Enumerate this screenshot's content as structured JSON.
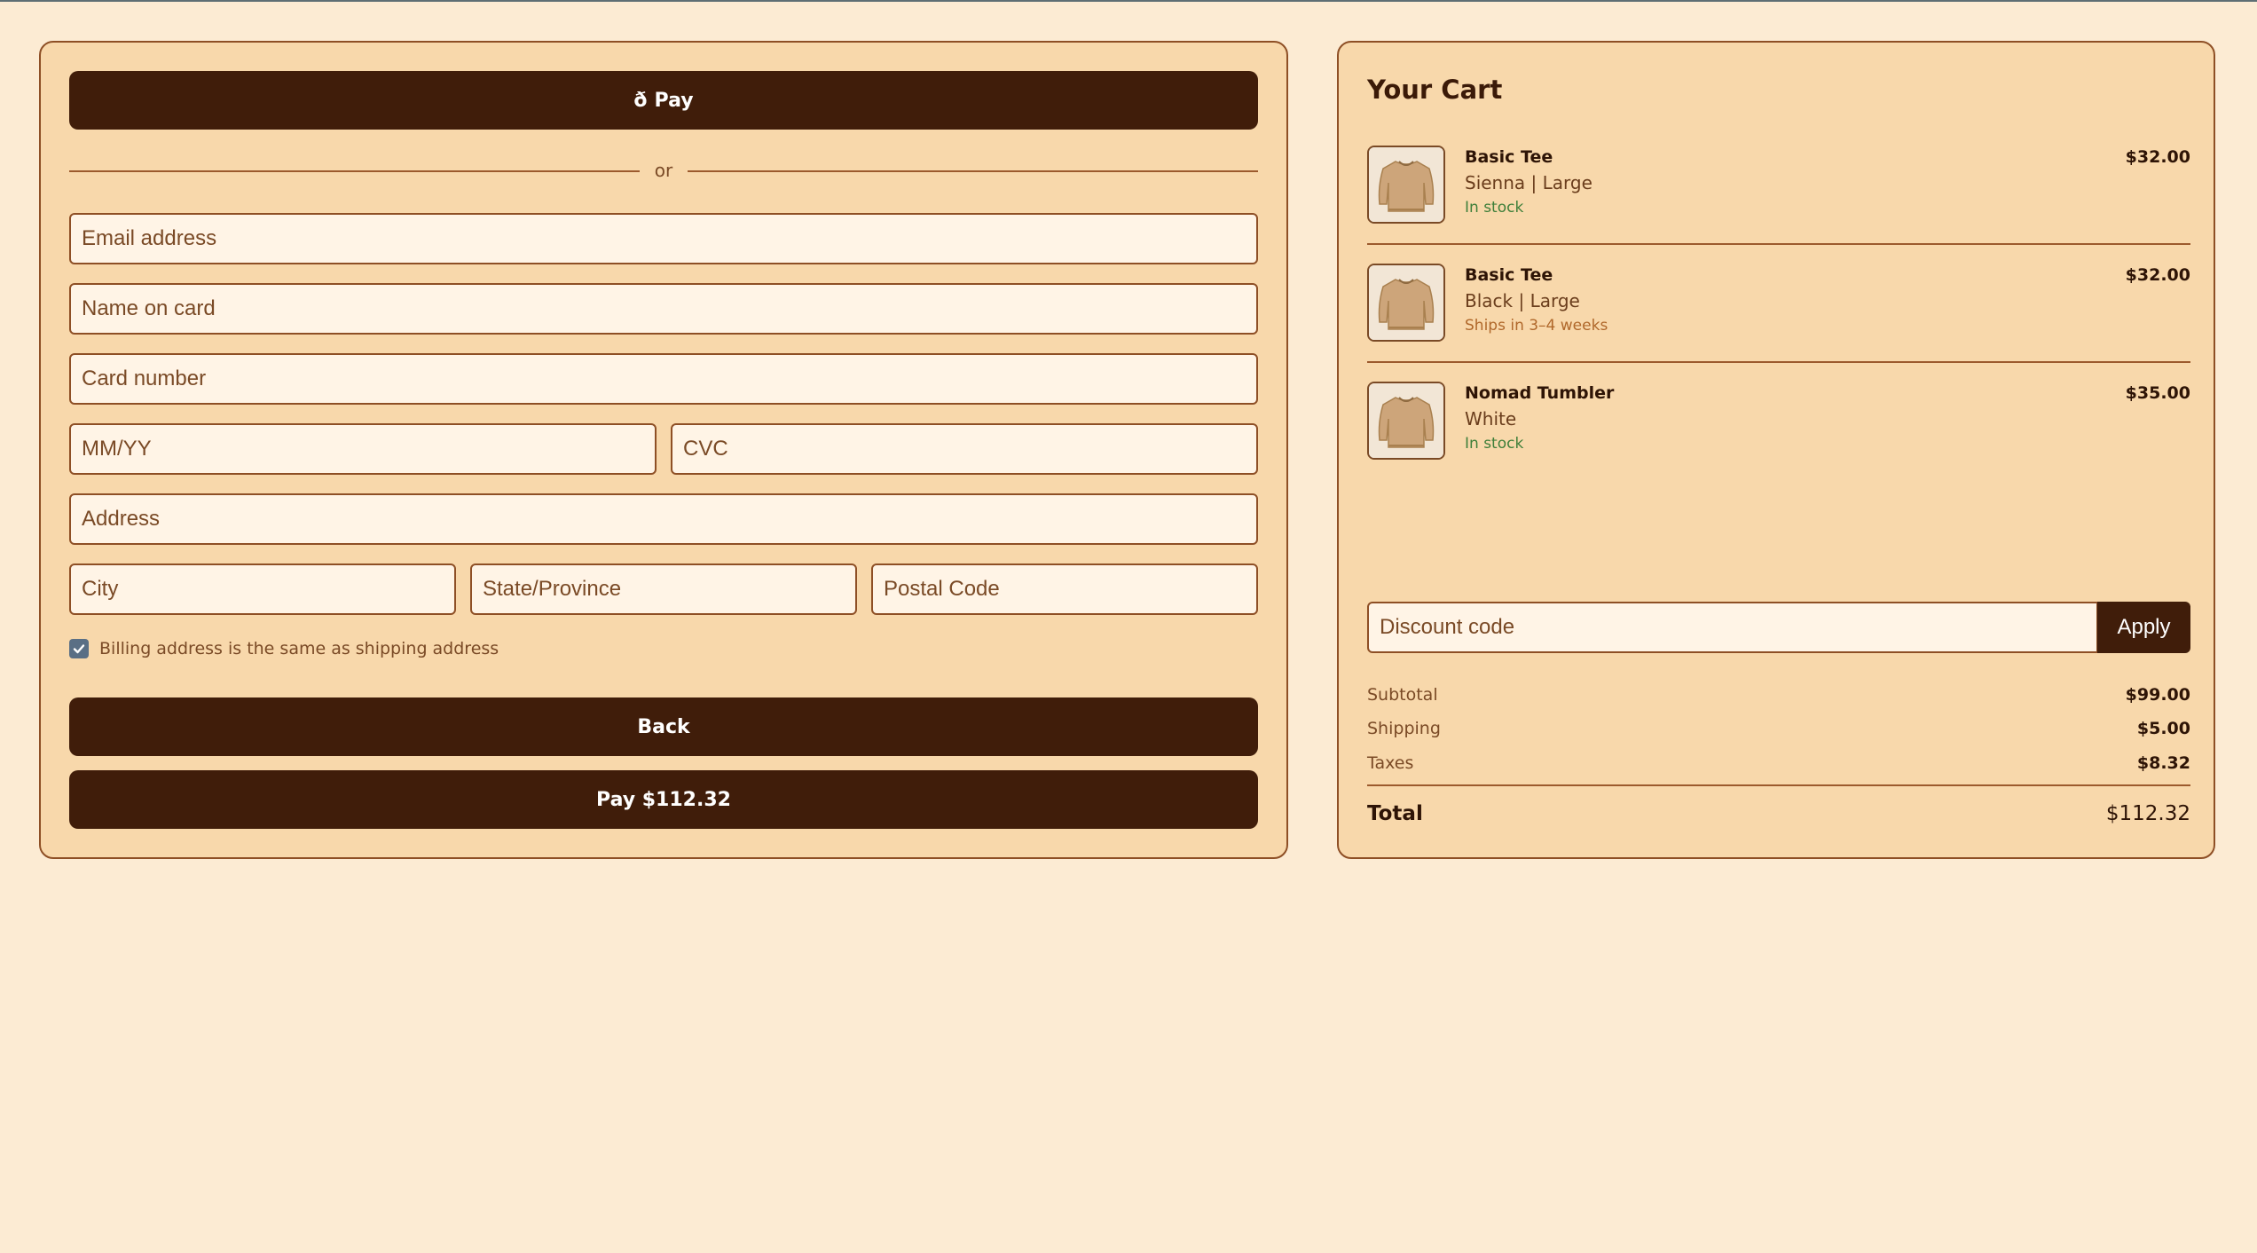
{
  "checkout": {
    "applepay_label": "Pay",
    "or_label": "or",
    "fields": {
      "email": "Email address",
      "name": "Name on card",
      "card_number": "Card number",
      "expiry": "MM/YY",
      "cvc": "CVC",
      "address": "Address",
      "city": "City",
      "state": "State/Province",
      "postal": "Postal Code"
    },
    "billing_same": {
      "label": "Billing address is the same as shipping address",
      "checked": true
    },
    "back_label": "Back",
    "pay_label": "Pay $112.32"
  },
  "cart": {
    "title": "Your Cart",
    "items": [
      {
        "name": "Basic Tee",
        "variant": "Sienna | Large",
        "stock": "In stock",
        "price": "$32.00",
        "image": "sweater-image"
      },
      {
        "name": "Basic Tee",
        "variant": "Black | Large",
        "stock": "Ships in 3–4 weeks",
        "price": "$32.00",
        "image": "sweater-image"
      },
      {
        "name": "Nomad Tumbler",
        "variant": "White",
        "stock": "In stock",
        "price": "$35.00",
        "image": "sweater-image"
      }
    ],
    "discount": {
      "placeholder": "Discount code",
      "apply_label": "Apply"
    },
    "summary": {
      "subtotal_label": "Subtotal",
      "subtotal": "$99.00",
      "shipping_label": "Shipping",
      "shipping": "$5.00",
      "taxes_label": "Taxes",
      "taxes": "$8.32",
      "total_label": "Total",
      "total": "$112.32"
    }
  },
  "colors": {
    "background": "#fcebd3",
    "panel": "#f8d8ab",
    "dark_button": "#401d0a",
    "in_stock": "#3f7f3a",
    "backorder": "#b0682b"
  }
}
